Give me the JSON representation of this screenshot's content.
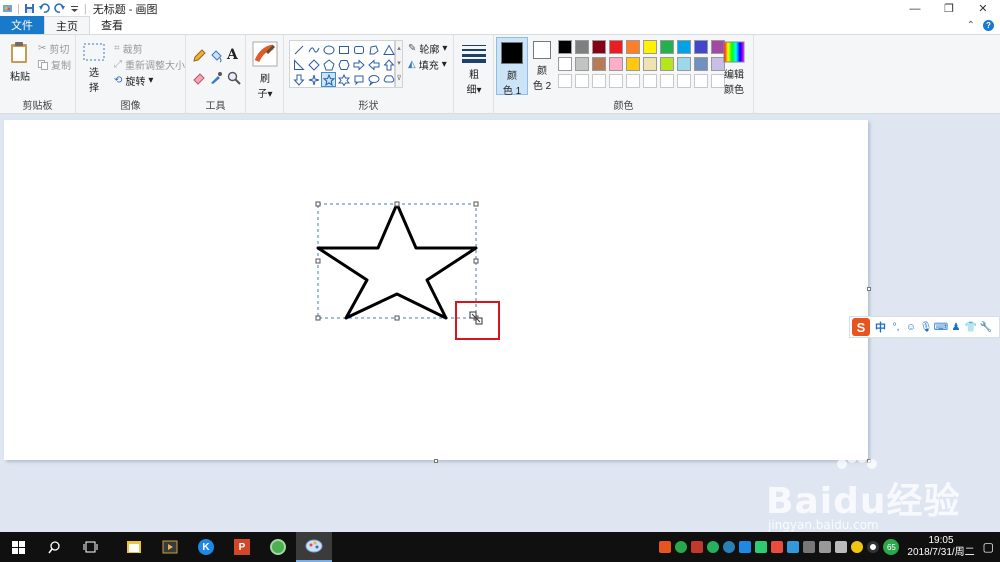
{
  "window": {
    "title": "无标题 - 画图"
  },
  "tabs": [
    {
      "label": "文件"
    },
    {
      "label": "主页"
    },
    {
      "label": "查看"
    }
  ],
  "ribbon": {
    "clipboard": {
      "group_label": "剪贴板",
      "paste": "粘贴",
      "cut": "剪切",
      "copy": "复制"
    },
    "image": {
      "group_label": "图像",
      "select_line1": "选",
      "select_line2": "择",
      "crop": "裁剪",
      "resize": "重新调整大小",
      "rotate": "旋转"
    },
    "tools": {
      "group_label": "工具"
    },
    "brushes": {
      "label_line1": "刷",
      "label_line2": "子"
    },
    "shapes": {
      "group_label": "形状",
      "outline": "轮廓",
      "fill": "填充"
    },
    "size": {
      "label_line1": "粗",
      "label_line2": "细"
    },
    "colors": {
      "group_label": "颜色",
      "color1_line1": "颜",
      "color1_line2": "色 1",
      "color2_line1": "颜",
      "color2_line2": "色 2",
      "edit_line1": "编辑",
      "edit_line2": "颜色",
      "color1": "#000000",
      "color2": "#ffffff",
      "palette": [
        "#000000",
        "#7f7f7f",
        "#880015",
        "#ed1c24",
        "#ff7f27",
        "#fff200",
        "#22b14c",
        "#00a2e8",
        "#3f48cc",
        "#a349a4",
        "#ffffff",
        "#c3c3c3",
        "#b97a57",
        "#ffaec9",
        "#ffc90e",
        "#efe4b0",
        "#b5e61d",
        "#99d9ea",
        "#7092be",
        "#c8bfe7"
      ]
    }
  },
  "ime": {
    "lang": "中"
  },
  "watermark": {
    "brand": "Baidu经验",
    "url": "jingyan.baidu.com"
  },
  "taskbar": {
    "time": "19:05",
    "date": "2018/7/31/周二",
    "badge": "65"
  }
}
